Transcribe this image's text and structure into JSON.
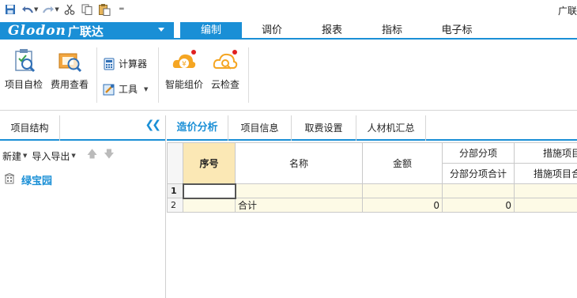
{
  "window": {
    "title_partial": "广联"
  },
  "quick_access": {
    "icons": [
      "save-icon",
      "undo-icon",
      "redo-icon",
      "cut-icon",
      "copy-icon",
      "paste-icon",
      "customize-icon"
    ]
  },
  "brand": {
    "logo_latin": "Glodon",
    "logo_cn": "广联达"
  },
  "ribbon_tabs": [
    {
      "label": "编制",
      "active": true
    },
    {
      "label": "调价",
      "active": false
    },
    {
      "label": "报表",
      "active": false
    },
    {
      "label": "指标",
      "active": false
    },
    {
      "label": "电子标",
      "active": false
    }
  ],
  "ribbon": {
    "project_check": "项目自检",
    "fee_check": "费用查看",
    "calculator": "计算器",
    "tools": "工具",
    "smart_price": "智能组价",
    "cloud_check": "云检查"
  },
  "left_pane": {
    "tab": "项目结构",
    "new_label": "新建",
    "import_export_label": "导入导出",
    "tree_root": "绿宝园"
  },
  "content_tabs": [
    {
      "label": "造价分析",
      "active": true
    },
    {
      "label": "项目信息",
      "active": false
    },
    {
      "label": "取费设置",
      "active": false
    },
    {
      "label": "人材机汇总",
      "active": false
    }
  ],
  "table": {
    "headers": {
      "seq": "序号",
      "name": "名称",
      "amount": "金额",
      "sub_group": "分部分项",
      "sub_total": "分部分项合计",
      "measure_group": "措施项目",
      "measure_total": "措施项目合计"
    },
    "rows": [
      {
        "num": "1",
        "seq": "",
        "name": "",
        "amount": "",
        "sub_total": "",
        "measure_total": ""
      },
      {
        "num": "2",
        "seq": "",
        "name": "合计",
        "amount": "0",
        "sub_total": "0",
        "measure_total": ""
      }
    ]
  },
  "colors": {
    "accent": "#1a8fd6",
    "header_highlight": "#fbe8b5",
    "row_bg": "#fdfae6"
  }
}
